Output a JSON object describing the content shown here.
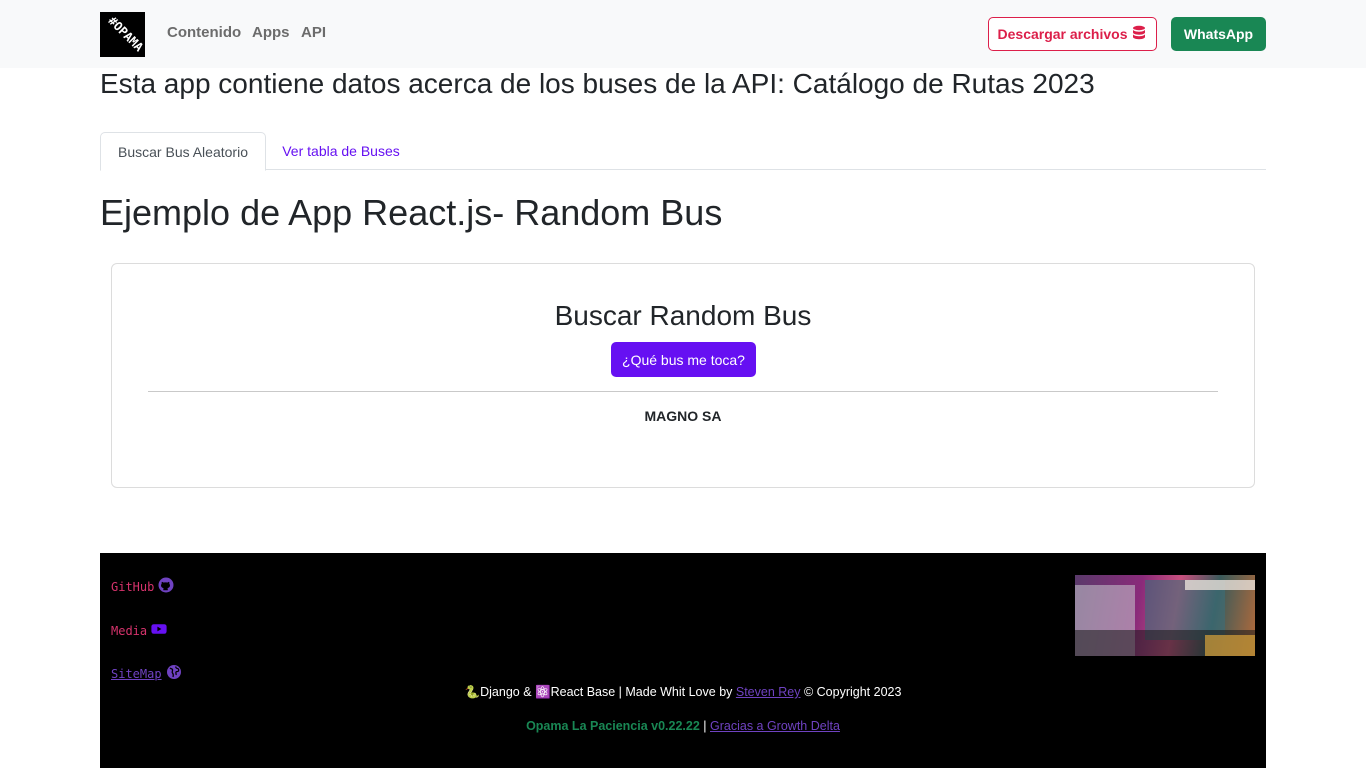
{
  "navbar": {
    "brand_text": "#OPAMA",
    "links": [
      "Contenido",
      "Apps",
      "API"
    ],
    "download_label": "Descargar archivos",
    "whatsapp_label": "WhatsApp"
  },
  "main": {
    "heading": "Esta app contiene datos acerca de los buses de la API: Catálogo de Rutas 2023",
    "tabs": [
      {
        "label": "Buscar Bus Aleatorio",
        "active": true
      },
      {
        "label": "Ver tabla de Buses",
        "active": false
      }
    ],
    "section_title": "Ejemplo de App React.js- Random Bus",
    "card": {
      "title": "Buscar Random Bus",
      "button_label": "¿Qué bus me toca?",
      "result": "MAGNO SA"
    }
  },
  "footer": {
    "links": [
      {
        "label": "GitHub",
        "icon": "github-icon"
      },
      {
        "label": "Media",
        "icon": "youtube-icon"
      },
      {
        "label": "SiteMap",
        "icon": "globe-icon"
      }
    ],
    "credit_prefix": "🐍Django & ⚛️React Base | Made Whit Love by ",
    "credit_author": "Steven Rey",
    "credit_suffix": " © Copyright 2023",
    "version": "Opama La Paciencia v0.22.22",
    "version_sep": " | ",
    "thanks": "Gracias a Growth Delta"
  },
  "colors": {
    "accent": "#6610f2",
    "danger": "#dc1f4a",
    "success": "#198754",
    "navbar_bg": "#f8f9fa",
    "footer_bg": "#000000"
  }
}
